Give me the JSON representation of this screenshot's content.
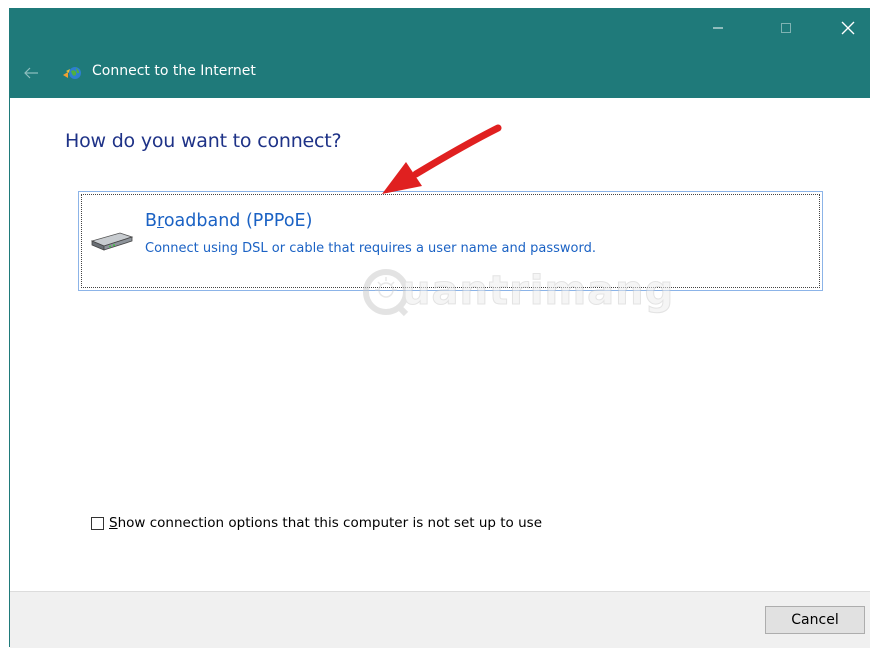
{
  "window": {
    "title": "Connect to the Internet",
    "controls": {
      "minimize": "—",
      "maximize": "☐",
      "close": "✕"
    },
    "back_icon": "back-arrow-icon",
    "app_icon": "network-globe-icon",
    "accent_color": "#1f7a7a"
  },
  "main": {
    "heading": "How do you want to connect?",
    "options": [
      {
        "title_prefix": "B",
        "title_underlined": "r",
        "title_rest": "oadband (PPPoE)",
        "description": "Connect using DSL or cable that requires a user name and password.",
        "icon": "modem-icon"
      }
    ],
    "watermark": "uantrimang"
  },
  "checkbox": {
    "checked": false,
    "label_underlined": "S",
    "label_rest": "how connection options that this computer is not set up to use"
  },
  "footer": {
    "cancel_label": "Cancel"
  },
  "colors": {
    "heading": "#1e3287",
    "link": "#1b62c4",
    "annotation_arrow": "#e02020"
  }
}
